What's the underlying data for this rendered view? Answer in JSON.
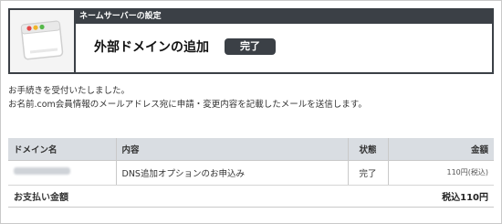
{
  "header": {
    "section_title": "ネームサーバーの設定",
    "page_title": "外部ドメインの追加",
    "status_badge": "完了",
    "icon": "browser-window-icon"
  },
  "messages": [
    "お手続きを受付いたしました。",
    "お名前.com会員情報のメールアドレス宛に申請・変更内容を記載したメールを送信します。"
  ],
  "table": {
    "headers": {
      "domain": "ドメイン名",
      "content": "内容",
      "status": "状態",
      "amount": "金額"
    },
    "rows": [
      {
        "content": "DNS追加オプションのお申込み",
        "status": "完了",
        "amount": "110円(税込)"
      }
    ],
    "total": {
      "label": "お支払い金額",
      "value": "税込110円"
    }
  },
  "colors": {
    "header_dark": "#3b4046",
    "table_header_bg": "#d9dde2"
  }
}
